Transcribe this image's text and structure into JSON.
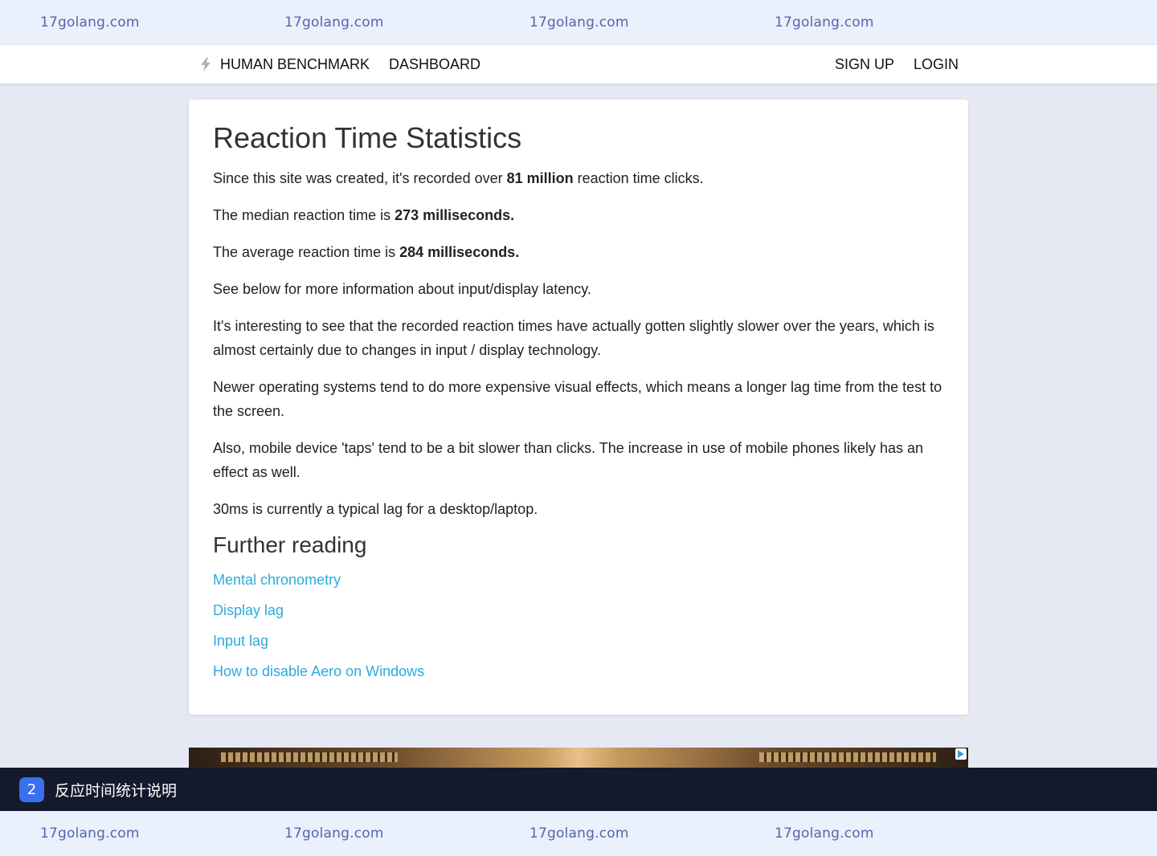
{
  "watermark": {
    "top": [
      "17golang.com",
      "17golang.com",
      "17golang.com",
      "17golang.com"
    ],
    "bottom": [
      "17golang.com",
      "17golang.com",
      "17golang.com",
      "17golang.com"
    ]
  },
  "nav": {
    "brand": "HUMAN BENCHMARK",
    "dashboard": "DASHBOARD",
    "signup": "SIGN UP",
    "login": "LOGIN"
  },
  "content": {
    "title": "Reaction Time Statistics",
    "p1_before": "Since this site was created, it's recorded over ",
    "p1_bold": "81 million",
    "p1_after": " reaction time clicks.",
    "p2_before": "The median reaction time is ",
    "p2_bold": "273 milliseconds.",
    "p3_before": "The average reaction time is ",
    "p3_bold": "284 milliseconds.",
    "p4": "See below for more information about input/display latency.",
    "p5": "It's interesting to see that the recorded reaction times have actually gotten slightly slower over the years, which is almost certainly due to changes in input / display technology.",
    "p6": "Newer operating systems tend to do more expensive visual effects, which means a longer lag time from the test to the screen.",
    "p7": "Also, mobile device 'taps' tend to be a bit slower than clicks. The increase in use of mobile phones likely has an effect as well.",
    "p8": "30ms is currently a typical lag for a desktop/laptop.",
    "further_heading": "Further reading",
    "links": [
      "Mental chronometry",
      "Display lag",
      "Input lag",
      "How to disable Aero on Windows"
    ]
  },
  "footer": {
    "step_number": "2",
    "step_title": "反应时间统计说明"
  },
  "colors": {
    "link": "#2eaadc",
    "step_badge": "#3a6ff0",
    "footer_bg": "#141a2c",
    "page_bg": "#e6e8f4",
    "watermark_text": "#5566aa"
  },
  "icons": [
    "bolt-icon",
    "ad-choices-icon"
  ]
}
